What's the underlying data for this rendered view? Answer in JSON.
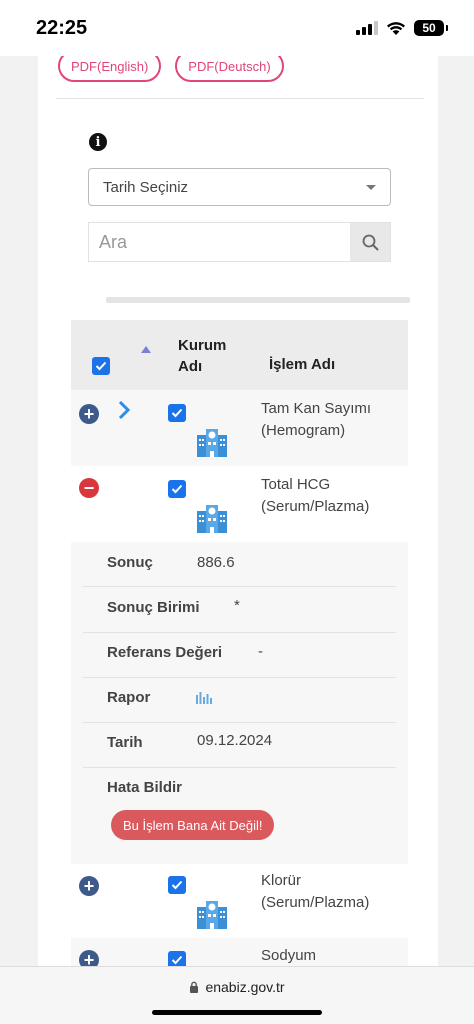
{
  "status": {
    "time": "22:25",
    "battery": "50"
  },
  "pdf": {
    "english": "PDF(English)",
    "deutsch": "PDF(Deutsch)"
  },
  "filters": {
    "date_select": "Tarih Seçiniz",
    "search_placeholder": "Ara"
  },
  "table": {
    "col_kurum": "Kurum Adı",
    "col_islem": "İşlem Adı"
  },
  "rows": [
    {
      "name": "Tam Kan Sayımı (Hemogram)"
    },
    {
      "name": "Total HCG (Serum/Plazma)"
    },
    {
      "name": "Klorür (Serum/Plazma)"
    },
    {
      "name": "Sodyum"
    }
  ],
  "details": {
    "sonuc_label": "Sonuç",
    "sonuc_value": "886.6",
    "birim_label": "Sonuç Birimi",
    "birim_value": "*",
    "referans_label": "Referans Değeri",
    "referans_value": "-",
    "rapor_label": "Rapor",
    "tarih_label": "Tarih",
    "tarih_value": "09.12.2024",
    "hata_label": "Hata Bildir",
    "report_button": "Bu İşlem Bana Ait Değil!"
  },
  "browser": {
    "url": "enabiz.gov.tr"
  },
  "colors": {
    "pink": "#e0457b",
    "blue": "#1a73e8",
    "red": "#d9363e",
    "navy": "#3d5a8a"
  }
}
